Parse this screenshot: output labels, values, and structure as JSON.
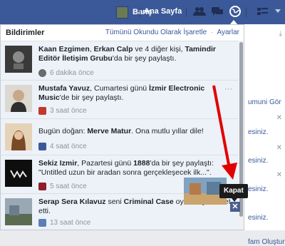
{
  "topbar": {
    "user_name": "Barış",
    "home_label": "Ana Sayfa",
    "icons": [
      "friend-requests-icon",
      "messages-icon",
      "globe-icon",
      "privacy-icon",
      "dropdown-arrow-icon"
    ],
    "background": "#3b5998"
  },
  "notifications": {
    "title": "Bildirimler",
    "mark_all_read": "Tümünü Okundu Olarak İşaretle",
    "separator": "·",
    "settings": "Ayarlar",
    "items": [
      {
        "actor": "Kaan Ezgimen",
        "text_1": ", ",
        "actor_2": "Erkan Calp",
        "text_2": " ve 4 diğer kişi, ",
        "group": "Tamindir Editör İletişim Grubu",
        "text_3": "'da bir şey paylaştı.",
        "time": "6 dakika önce",
        "type_icon": "skull-icon"
      },
      {
        "actor": "Mustafa Yavuz",
        "text_1": ", Cumartesi günü ",
        "target": "İzmir Electronic Music",
        "text_2": "'de bir şey paylaştı.",
        "time": "3 saat önce",
        "type_icon": "cup-icon"
      },
      {
        "text_1": "Bugün doğan: ",
        "actor": "Merve Matur",
        "text_2": ". Ona mutlu yıllar dile!",
        "time": "4 saat önce",
        "type_icon": "facebook-icon"
      },
      {
        "actor": "Sekiz Izmir",
        "text_1": ", Pazartesi günü ",
        "target": "1888",
        "text_2": "'da bir şey paylaştı: \"Untitled uzun bir aradan sonra gerçekleşecek ilk...\".",
        "time": "5 saat önce",
        "type_icon": "wine-icon"
      },
      {
        "actor": "Serap Sera Kılavuz",
        "text_1": " seni ",
        "target": "Criminal Case",
        "text_2": " oynamaya davet etti.",
        "time": "13 saat önce",
        "type_icon": "game-icon"
      }
    ]
  },
  "tooltip": {
    "label": "Kapat"
  },
  "close_glyph": "✕",
  "ellipsis": "···",
  "right_column": {
    "line_1": "umuni Gör",
    "line_2": "esiniz.",
    "line_3": "esiniz.",
    "line_4": "esiniz.",
    "line_5": "esiniz.",
    "line_6": "fam Oluştur"
  }
}
